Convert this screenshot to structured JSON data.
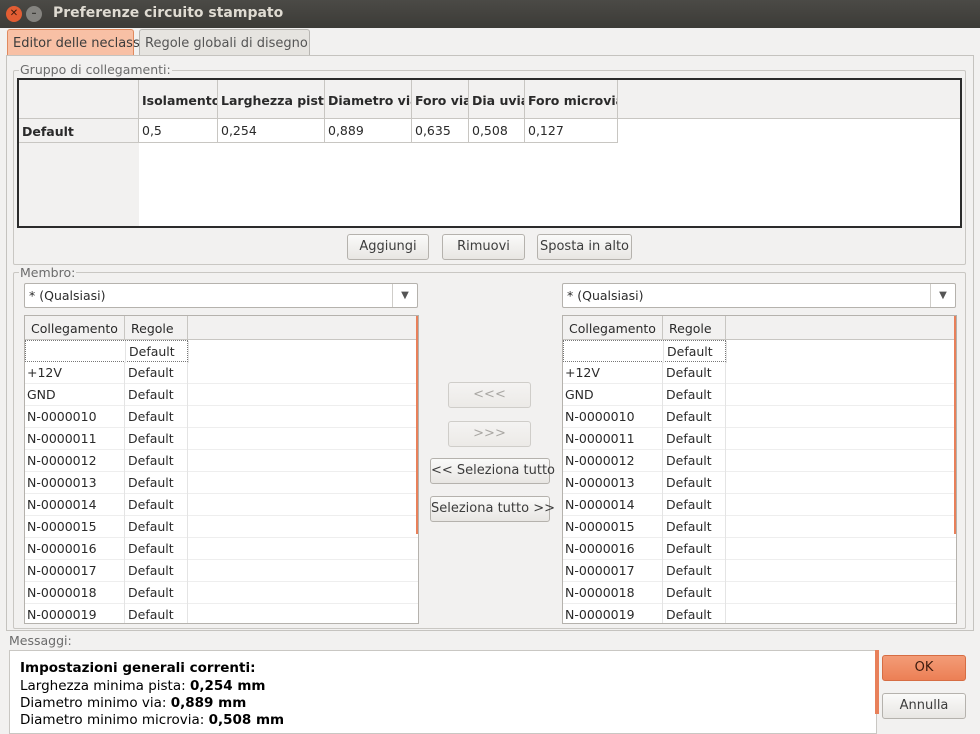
{
  "window": {
    "title": "Preferenze circuito stampato"
  },
  "tabs": [
    {
      "label": "Editor delle neclass",
      "active": true
    },
    {
      "label": "Regole globali di disegno",
      "active": false
    }
  ],
  "netclass_group": {
    "title": "Gruppo di collegamenti:",
    "columns": [
      "Isolamento",
      "Larghezza piste",
      "Diametro via",
      "Foro via",
      "Dia uvia",
      "Foro microvia"
    ],
    "rows": [
      {
        "label": "Default",
        "values": [
          "0,5",
          "0,254",
          "0,889",
          "0,635",
          "0,508",
          "0,127"
        ]
      }
    ],
    "buttons": {
      "add": "Aggiungi",
      "remove": "Rimuovi",
      "move_up": "Sposta in alto"
    }
  },
  "members": {
    "title": "Membro:",
    "left_filter": "* (Qualsiasi)",
    "right_filter": "* (Qualsiasi)",
    "headers": [
      "Collegamento",
      "Regole"
    ],
    "left_rows": [
      {
        "net": "",
        "rule": "Default"
      },
      {
        "net": "+12V",
        "rule": "Default"
      },
      {
        "net": "GND",
        "rule": "Default"
      },
      {
        "net": "N-0000010",
        "rule": "Default"
      },
      {
        "net": "N-0000011",
        "rule": "Default"
      },
      {
        "net": "N-0000012",
        "rule": "Default"
      },
      {
        "net": "N-0000013",
        "rule": "Default"
      },
      {
        "net": "N-0000014",
        "rule": "Default"
      },
      {
        "net": "N-0000015",
        "rule": "Default"
      },
      {
        "net": "N-0000016",
        "rule": "Default"
      },
      {
        "net": "N-0000017",
        "rule": "Default"
      },
      {
        "net": "N-0000018",
        "rule": "Default"
      },
      {
        "net": "N-0000019",
        "rule": "Default"
      }
    ],
    "right_rows": [
      {
        "net": "",
        "rule": "Default"
      },
      {
        "net": "+12V",
        "rule": "Default"
      },
      {
        "net": "GND",
        "rule": "Default"
      },
      {
        "net": "N-0000010",
        "rule": "Default"
      },
      {
        "net": "N-0000011",
        "rule": "Default"
      },
      {
        "net": "N-0000012",
        "rule": "Default"
      },
      {
        "net": "N-0000013",
        "rule": "Default"
      },
      {
        "net": "N-0000014",
        "rule": "Default"
      },
      {
        "net": "N-0000015",
        "rule": "Default"
      },
      {
        "net": "N-0000016",
        "rule": "Default"
      },
      {
        "net": "N-0000017",
        "rule": "Default"
      },
      {
        "net": "N-0000018",
        "rule": "Default"
      },
      {
        "net": "N-0000019",
        "rule": "Default"
      }
    ],
    "move_left": "<<<",
    "move_right": ">>>",
    "select_all_left": "<< Seleziona tutto",
    "select_all_right": "Seleziona tutto >>"
  },
  "messages": {
    "title": "Messaggi:",
    "heading": "Impostazioni generali correnti:",
    "lines": [
      {
        "label": "Larghezza minima pista:",
        "value": "0,254 mm"
      },
      {
        "label": "Diametro minimo via:",
        "value": "0,889 mm"
      },
      {
        "label": "Diametro minimo microvia:",
        "value": "0,508 mm"
      }
    ]
  },
  "dialog_buttons": {
    "ok": "OK",
    "cancel": "Annulla"
  },
  "colors": {
    "accent": "#e8805a",
    "titlebar": "#3c3b37"
  }
}
